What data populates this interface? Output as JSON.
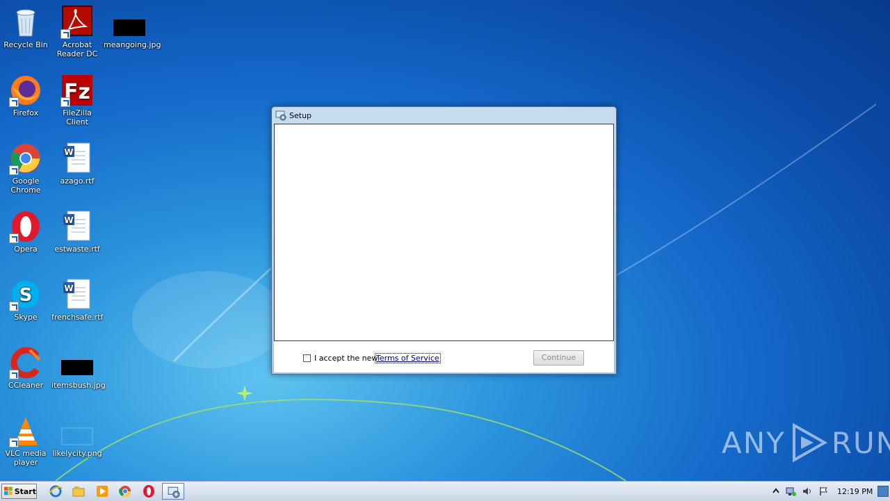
{
  "desktop": {
    "icons": [
      {
        "label": "Recycle Bin",
        "icon": "recycle-bin-icon"
      },
      {
        "label": "Acrobat Reader DC",
        "icon": "acrobat-icon"
      },
      {
        "label": "meangoing.jpg",
        "icon": "image-file-icon"
      },
      {
        "label": "Firefox",
        "icon": "firefox-icon"
      },
      {
        "label": "FileZilla Client",
        "icon": "filezilla-icon"
      },
      {
        "label": "Google Chrome",
        "icon": "chrome-icon"
      },
      {
        "label": "azago.rtf",
        "icon": "word-doc-icon"
      },
      {
        "label": "Opera",
        "icon": "opera-icon"
      },
      {
        "label": "estwaste.rtf",
        "icon": "word-doc-icon"
      },
      {
        "label": "Skype",
        "icon": "skype-icon"
      },
      {
        "label": "frenchsafe.rtf",
        "icon": "word-doc-icon"
      },
      {
        "label": "CCleaner",
        "icon": "ccleaner-icon"
      },
      {
        "label": "itemsbush.jpg",
        "icon": "image-file-icon"
      },
      {
        "label": "VLC media player",
        "icon": "vlc-icon"
      },
      {
        "label": "likelycity.png",
        "icon": "image-file-icon"
      }
    ]
  },
  "window": {
    "title": "Setup",
    "accept_label": "I accept the new",
    "tos_link": "Terms of Service",
    "continue_label": "Continue",
    "checkbox_checked": false,
    "continue_enabled": false
  },
  "watermark": {
    "left": "ANY",
    "right": "RUN"
  },
  "taskbar": {
    "start_label": "Start",
    "pinned": [
      "ie-icon",
      "explorer-icon",
      "media-player-icon",
      "chrome-icon",
      "opera-icon",
      "setup-icon"
    ],
    "clock": "12:19 PM"
  },
  "colors": {
    "accent": "#1468c9",
    "link": "#000080"
  }
}
